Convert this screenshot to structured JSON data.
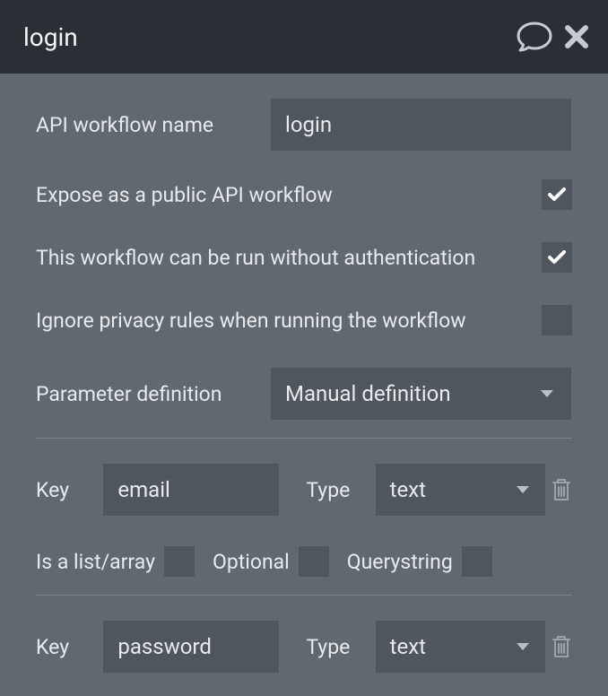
{
  "header": {
    "title": "login"
  },
  "form": {
    "name_label": "API workflow name",
    "name_value": "login",
    "expose_public_label": "Expose as a public API workflow",
    "expose_public_checked": true,
    "no_auth_label": "This workflow can be run without authentication",
    "no_auth_checked": true,
    "ignore_privacy_label": "Ignore privacy rules when running the workflow",
    "ignore_privacy_checked": false,
    "param_def_label": "Parameter definition",
    "param_def_value": "Manual definition"
  },
  "param_labels": {
    "key": "Key",
    "type": "Type",
    "is_list": "Is a list/array",
    "optional": "Optional",
    "querystring": "Querystring"
  },
  "params": [
    {
      "key": "email",
      "type": "text",
      "is_list": false,
      "optional": false,
      "querystring": false
    },
    {
      "key": "password",
      "type": "text",
      "is_list": false,
      "optional": false,
      "querystring": false
    }
  ]
}
